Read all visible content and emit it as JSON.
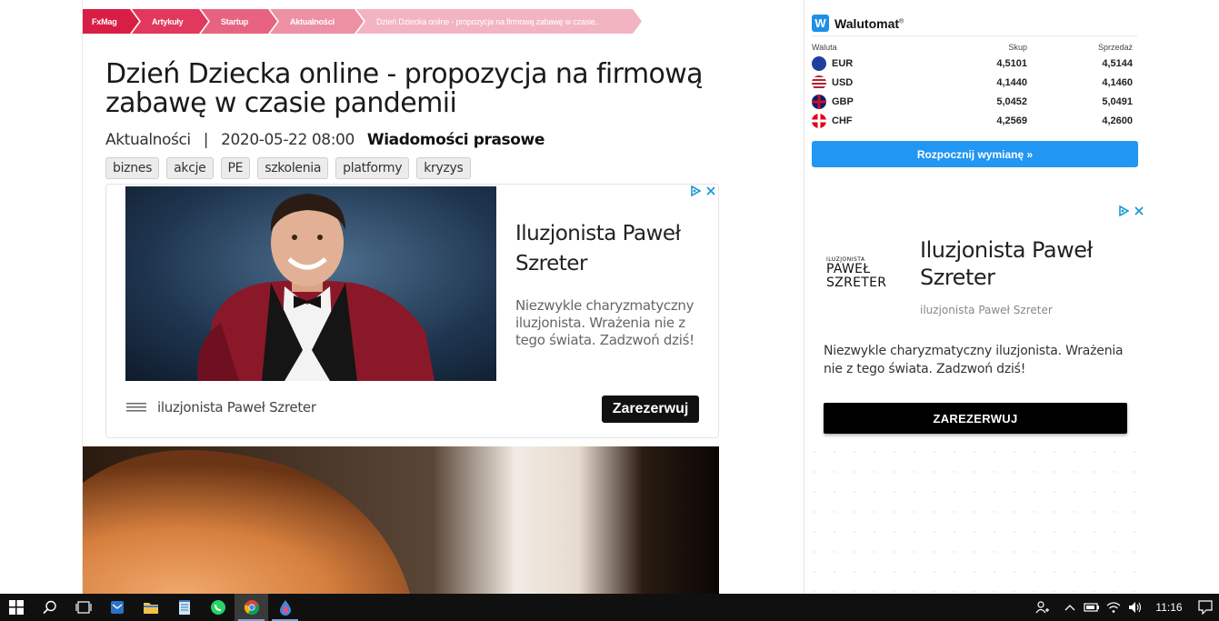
{
  "breadcrumb": {
    "items": [
      {
        "label": "FxMag",
        "color": "#d91e45"
      },
      {
        "label": "Artykuły",
        "color": "#e2385d"
      },
      {
        "label": "Startup",
        "color": "#e8637f"
      },
      {
        "label": "Aktualności",
        "color": "#ee90a4"
      },
      {
        "label": "Dzień Dziecka online - propozycja na firmową zabawę w czasie..",
        "color": "#f3b4c2"
      }
    ]
  },
  "article": {
    "title_line1": "Dzień Dziecka online - propozycja na firmową",
    "title_line2": "zabawę w czasie pandemii",
    "category": "Aktualności",
    "separator": "|",
    "date": "2020-05-22 08:00",
    "source": "Wiadomości prasowe",
    "tags": [
      "biznes",
      "akcje",
      "PE",
      "szkolenia",
      "platformy",
      "kryzys"
    ]
  },
  "ad_main": {
    "headline": "Iluzjonista Paweł Szreter",
    "description": "Niezwykle charyzmatyczny iluzjonista. Wrażenia nie z tego świata. Zadzwoń dziś!",
    "brand": "iluzjonista Paweł Szreter",
    "cta": "Zarezerwuj"
  },
  "walutomat": {
    "name": "Walutomat",
    "reg": "®",
    "headers": {
      "currency": "Waluta",
      "buy": "Skup",
      "sell": "Sprzedaż"
    },
    "rates": [
      {
        "code": "EUR",
        "buy": "4,5101",
        "sell": "4,5144",
        "flag_color": "#1f3fa0"
      },
      {
        "code": "USD",
        "buy": "4,1440",
        "sell": "4,1460",
        "flag_color": "#b22234"
      },
      {
        "code": "GBP",
        "buy": "5,0452",
        "sell": "5,0491",
        "flag_color": "#012169"
      },
      {
        "code": "CHF",
        "buy": "4,2569",
        "sell": "4,2600",
        "flag_color": "#e3001b"
      }
    ],
    "button": "Rozpocznij wymianę »"
  },
  "ad_side": {
    "logo_small": "ILUZJONISTA",
    "logo_line1": "PAWEŁ",
    "logo_line2": "SZRETER",
    "headline": "Iluzjonista Paweł Szreter",
    "sub": "iluzjonista Paweł Szreter",
    "description": "Niezwykle charyzmatyczny iluzjonista. Wrażenia nie z tego świata. Zadzwoń dziś!",
    "cta": "ZAREZERWUJ"
  },
  "taskbar": {
    "time": "11:16"
  }
}
